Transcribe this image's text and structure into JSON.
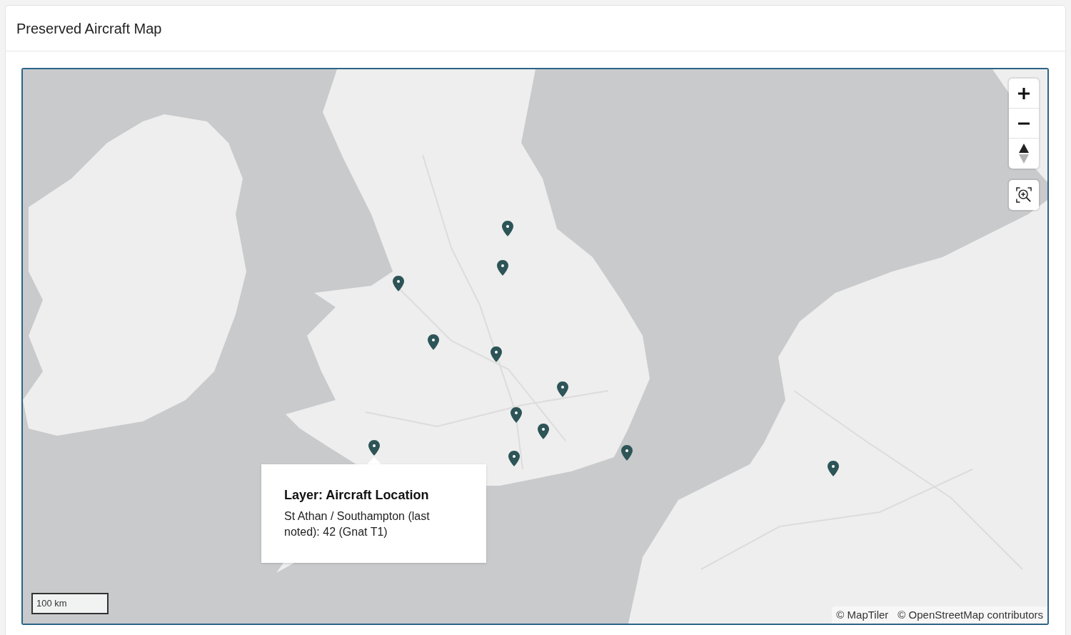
{
  "page": {
    "title": "Preserved Aircraft Map"
  },
  "map": {
    "popup": {
      "title": "Layer: Aircraft Location",
      "text": "St Athan / Southampton (last noted): 42 (Gnat T1)"
    },
    "scale": {
      "label": "100 km"
    },
    "attribution": [
      "© MapTiler",
      "© OpenStreetMap contributors"
    ]
  }
}
